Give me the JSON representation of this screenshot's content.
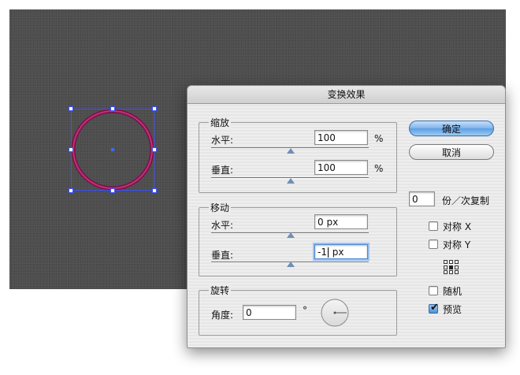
{
  "dialog": {
    "title": "变换效果",
    "scale": {
      "title": "缩放",
      "horizontal_label": "水平:",
      "horizontal_value": "100",
      "horizontal_unit": "%",
      "vertical_label": "垂直:",
      "vertical_value": "100",
      "vertical_unit": "%"
    },
    "move": {
      "title": "移动",
      "horizontal_label": "水平:",
      "horizontal_value": "0 px",
      "vertical_label": "垂直:",
      "vertical_value_before": "-1",
      "vertical_value_after": " px"
    },
    "rotate": {
      "title": "旋转",
      "angle_label": "角度:",
      "angle_value": "0",
      "degree_symbol": "°"
    },
    "ok_label": "确定",
    "cancel_label": "取消",
    "copies_value": "0",
    "copies_label": "份／次复制",
    "reflect_x_label": "对称 X",
    "reflect_y_label": "对称 Y",
    "random_label": "随机",
    "preview_label": "预览",
    "reflect_x_checked": false,
    "reflect_y_checked": false,
    "random_checked": false,
    "preview_checked": true
  },
  "colors": {
    "canvas": "#4d4d4d",
    "selection": "#3a50ff",
    "circle_stroke": "#9b1b5c",
    "primary_button": "#7db3ea"
  },
  "icons": [
    "reference-point-icon",
    "rotation-dial-icon",
    "check-icon"
  ]
}
